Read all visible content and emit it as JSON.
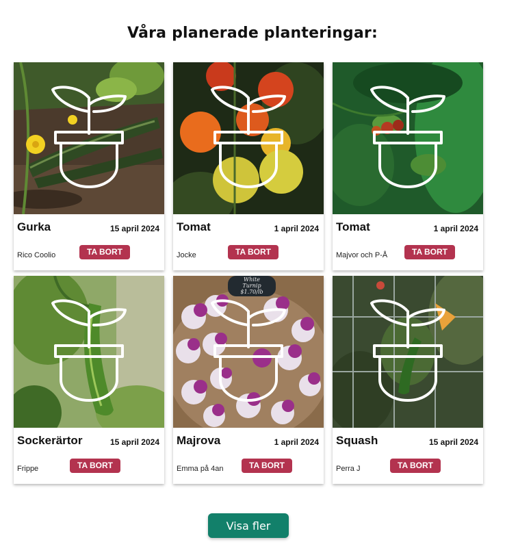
{
  "header": {
    "title": "Våra planerade planteringar:"
  },
  "cards": [
    {
      "name": "Gurka",
      "date": "15 april 2024",
      "owner": "Rico Coolio",
      "remove_label": "TA BORT",
      "image": "cucumber-photo"
    },
    {
      "name": "Tomat",
      "date": "1 april 2024",
      "owner": "Jocke",
      "remove_label": "TA BORT",
      "image": "tomato-photo"
    },
    {
      "name": "Tomat",
      "date": "1 april 2024",
      "owner": "Majvor och P-Å",
      "remove_label": "TA BORT",
      "image": "tomato-plant-photo"
    },
    {
      "name": "Sockerärtor",
      "date": "15 april 2024",
      "owner": "Frippe",
      "remove_label": "TA BORT",
      "image": "sugar-snap-pea-photo"
    },
    {
      "name": "Majrova",
      "date": "1 april 2024",
      "owner": "Emma på 4an",
      "remove_label": "TA BORT",
      "image": "turnip-photo",
      "sign_text": [
        "White",
        "Turnip",
        "$1.70/lb"
      ]
    },
    {
      "name": "Squash",
      "date": "15 april 2024",
      "owner": "Perra J",
      "remove_label": "TA BORT",
      "image": "squash-photo"
    }
  ],
  "footer": {
    "more_label": "Visa fler"
  },
  "colors": {
    "remove_button": "#b3334f",
    "more_button": "#12806a"
  },
  "icons": {
    "overlay": "potted-plant-icon"
  }
}
